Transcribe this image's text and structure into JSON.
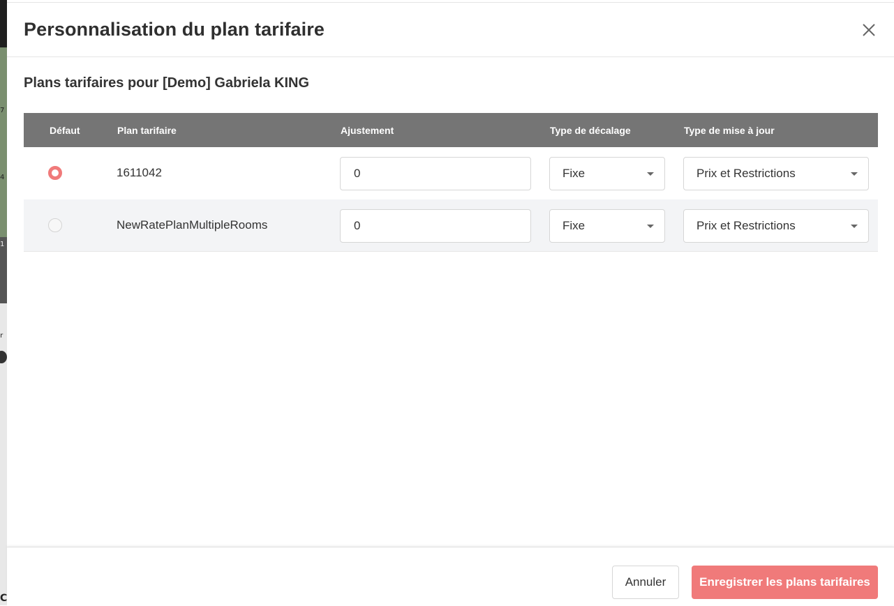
{
  "modal": {
    "title": "Personnalisation du plan tarifaire",
    "subtitle": "Plans tarifaires pour [Demo] Gabriela KING"
  },
  "table": {
    "headers": {
      "default": "Défaut",
      "rate_plan": "Plan tarifaire",
      "adjustment": "Ajustement",
      "offset_type": "Type de décalage",
      "update_type": "Type de mise à jour"
    },
    "rows": [
      {
        "selected": true,
        "rate_plan": "1611042",
        "adjustment": "0",
        "offset_type": "Fixe",
        "update_type": "Prix et Restrictions"
      },
      {
        "selected": false,
        "rate_plan": "NewRatePlanMultipleRooms",
        "adjustment": "0",
        "offset_type": "Fixe",
        "update_type": "Prix et Restrictions"
      }
    ]
  },
  "footer": {
    "cancel_label": "Annuler",
    "save_label": "Enregistrer les plans tarifaires"
  },
  "colors": {
    "accent": "#f07a7a",
    "header_bg": "#757575"
  },
  "background_glimpse": {
    "glyphs": [
      "7",
      "4",
      "1",
      "ar",
      "C"
    ]
  }
}
